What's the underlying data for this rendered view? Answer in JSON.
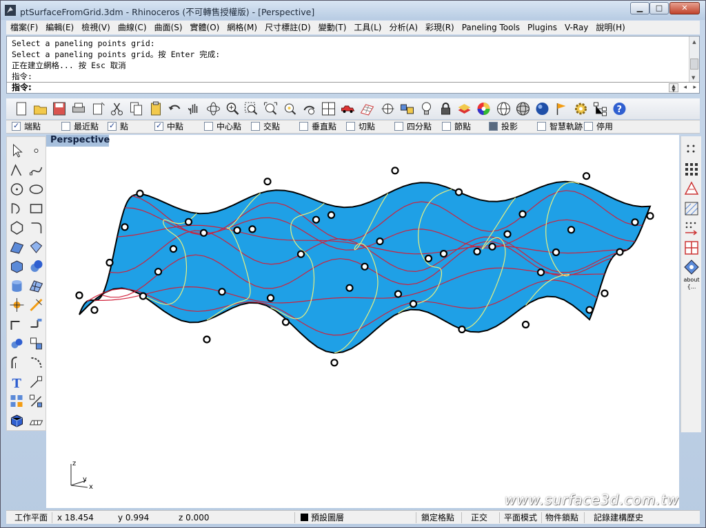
{
  "window": {
    "title": "ptSurfaceFromGrid.3dm - Rhinoceros (不可轉售授權版) - [Perspective]",
    "min_label": "▁",
    "max_label": "□",
    "close_label": "✕"
  },
  "menu": [
    "檔案(F)",
    "編輯(E)",
    "檢視(V)",
    "曲線(C)",
    "曲面(S)",
    "實體(O)",
    "網格(M)",
    "尺寸標註(D)",
    "變動(T)",
    "工具(L)",
    "分析(A)",
    "彩現(R)",
    "Paneling Tools",
    "Plugins",
    "V-Ray",
    "說明(H)"
  ],
  "command_history": [
    "Select a paneling points grid:",
    "Select a paneling points grid。按 Enter 完成:",
    "正在建立網格... 按 Esc 取消",
    "指令:"
  ],
  "command_prompt": "指令:",
  "osnaps": [
    {
      "label": "端點",
      "checked": true
    },
    {
      "label": "最近點",
      "checked": false
    },
    {
      "label": "點",
      "checked": true
    },
    {
      "label": "中點",
      "checked": true
    },
    {
      "label": "中心點",
      "checked": false
    },
    {
      "label": "交點",
      "checked": false
    },
    {
      "label": "垂直點",
      "checked": false
    },
    {
      "label": "切點",
      "checked": false
    },
    {
      "label": "四分點",
      "checked": false
    },
    {
      "label": "節點",
      "checked": false
    },
    {
      "label": "投影",
      "checked": true
    },
    {
      "label": "智慧軌跡",
      "checked": false
    },
    {
      "label": "停用",
      "checked": false
    }
  ],
  "viewport": {
    "title": "Perspective",
    "axis_z": "z",
    "axis_y": "y",
    "axis_x": "x",
    "watermark": "www.surface3d.com.tw",
    "surface_color": "#1fa0e6",
    "underside_color": "#d09a3a",
    "u_curve_color": "#d0203a",
    "v_curve_color": "#e8f080"
  },
  "right_tools_about": "about {...",
  "status": {
    "cplane": "工作平面",
    "x": "x 18.454",
    "y": "y 0.994",
    "z": "z 0.000",
    "layer": "預設圖層",
    "snap": "鎖定格點",
    "ortho": "正交",
    "planar": "平面模式",
    "osnap": "物件鎖點",
    "history": "記錄建構歷史"
  },
  "toolbar_icons": [
    "new-icon",
    "open-icon",
    "save-icon",
    "print-icon",
    "import-icon",
    "cut-icon",
    "copy-icon",
    "paste-icon",
    "undo-icon",
    "pan-icon",
    "rotate-view-icon",
    "zoom-icon",
    "zoom-window-icon",
    "zoom-extents-icon",
    "zoom-selected-icon",
    "undo-view-icon",
    "four-views-icon",
    "car-icon",
    "grid-icon",
    "cplane-icon",
    "snapshot-icon",
    "lightbulb-icon",
    "lock-icon",
    "layer-icon",
    "color-wheel-icon",
    "sphere-wire-icon",
    "sphere-mesh-icon",
    "sphere-render-icon",
    "flag-icon",
    "gear-icon",
    "tree-icon",
    "help-icon"
  ]
}
